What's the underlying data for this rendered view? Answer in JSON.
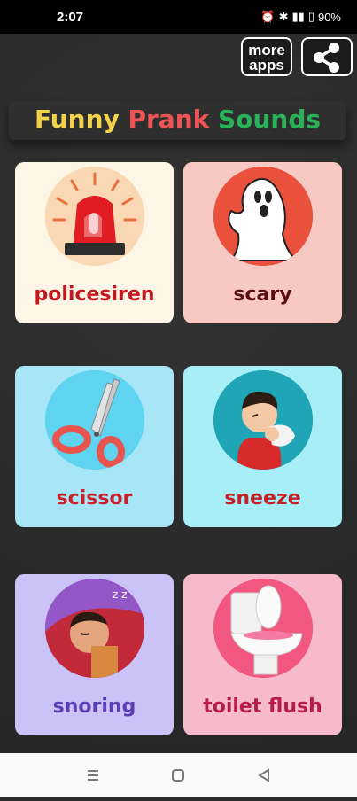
{
  "status": {
    "time": "2:07",
    "battery": "90%"
  },
  "header": {
    "more_apps_line1": "more",
    "more_apps_line2": "apps",
    "title_word1": "Funny",
    "title_word2": "Prank",
    "title_word3": "Sounds",
    "title_colors": [
      "#f2d24b",
      "#ee5454",
      "#27b356"
    ]
  },
  "sounds": [
    {
      "label": "policesiren",
      "bg": "#fdf5e6",
      "circle": "#fbd8b4",
      "text_color": "#c4161c",
      "icon": "police-siren-icon"
    },
    {
      "label": "scary",
      "bg": "#f8c9c3",
      "circle": "#e9513d",
      "text_color": "#5a0d12",
      "icon": "ghost-icon"
    },
    {
      "label": "scissor",
      "bg": "#a7e6f7",
      "circle": "#5fd4f0",
      "text_color": "#c8202c",
      "icon": "scissors-icon"
    },
    {
      "label": "sneeze",
      "bg": "#a8eef7",
      "circle": "#1fa5b5",
      "text_color": "#c4202a",
      "icon": "sneezing-boy-icon"
    },
    {
      "label": "snoring",
      "bg": "#cbc2f8",
      "circle": "#9357c8",
      "text_color": "#5b3eb5",
      "icon": "snoring-man-icon"
    },
    {
      "label": "toilet flush",
      "bg": "#f7b9cc",
      "circle": "#f2577f",
      "text_color": "#b51c4c",
      "icon": "toilet-icon"
    }
  ]
}
